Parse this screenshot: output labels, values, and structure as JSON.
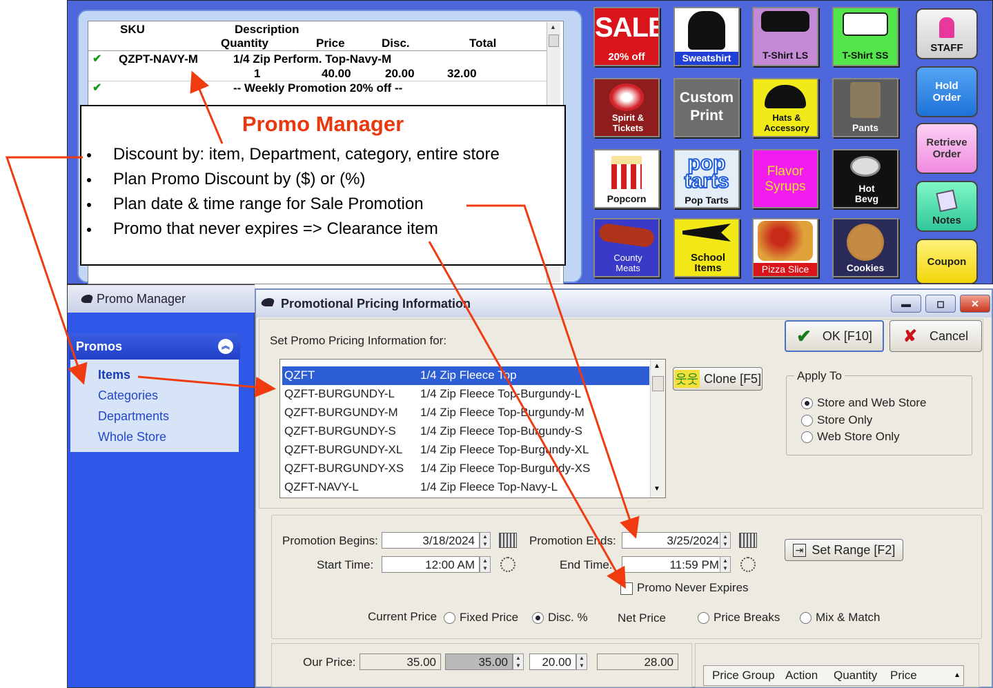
{
  "receipt": {
    "headers": {
      "sku": "SKU",
      "description": "Description",
      "quantity": "Quantity",
      "price": "Price",
      "disc": "Disc.",
      "total": "Total"
    },
    "line1": {
      "sku": "QZPT-NAVY-M",
      "description": "1/4 Zip Perform. Top-Navy-M",
      "quantity": "1",
      "price": "40.00",
      "disc": "20.00",
      "total": "32.00"
    },
    "line2": {
      "text": "-- Weekly Promotion 20% off --"
    }
  },
  "callout": {
    "title": "Promo Manager",
    "bullets": [
      "Discount by: item, Department, category, entire store",
      "Plan Promo Discount by ($) or (%)",
      "Plan date & time range for Sale Promotion",
      "Promo that never expires => Clearance item"
    ]
  },
  "tiles": [
    {
      "label": "SALE",
      "sub": "20% off"
    },
    {
      "label": "Sweatshirt"
    },
    {
      "label": "T-Shirt LS"
    },
    {
      "label": "T-Shirt SS"
    },
    {
      "label": "STAFF"
    },
    {
      "label": "Spirit & Tickets"
    },
    {
      "label": "Custom Print"
    },
    {
      "label": "Hats & Accessory"
    },
    {
      "label": "Pants"
    },
    {
      "label": "Hold Order"
    },
    {
      "label": "Popcorn"
    },
    {
      "label": "Pop Tarts"
    },
    {
      "label": "Flavor Syrups"
    },
    {
      "label": "Hot Bevg"
    },
    {
      "label": "Retrieve Order"
    },
    {
      "label": "County Meats"
    },
    {
      "label": "School Items"
    },
    {
      "label": "Pizza Slice"
    },
    {
      "label": "Cookies"
    },
    {
      "label": "Notes"
    },
    {
      "label": "Coupon"
    }
  ],
  "tile_text": {
    "poptarts_logo": "pop tarts"
  },
  "promo_manager": {
    "title": "Promo Manager",
    "section": "Promos",
    "links": [
      "Items",
      "Categories",
      "Departments",
      "Whole Store"
    ]
  },
  "ppi": {
    "title": "Promotional Pricing Information",
    "set_for_label": "Set Promo Pricing Information for:",
    "ok_label": "OK [F10]",
    "cancel_label": "Cancel",
    "clone_label": "Clone [F5]",
    "items": [
      {
        "sku": "QZFT",
        "desc": "1/4 Zip Fleece Top"
      },
      {
        "sku": "QZFT-BURGUNDY-L",
        "desc": "1/4 Zip Fleece Top-Burgundy-L"
      },
      {
        "sku": "QZFT-BURGUNDY-M",
        "desc": "1/4 Zip Fleece Top-Burgundy-M"
      },
      {
        "sku": "QZFT-BURGUNDY-S",
        "desc": "1/4 Zip Fleece Top-Burgundy-S"
      },
      {
        "sku": "QZFT-BURGUNDY-XL",
        "desc": "1/4 Zip Fleece Top-Burgundy-XL"
      },
      {
        "sku": "QZFT-BURGUNDY-XS",
        "desc": "1/4 Zip Fleece Top-Burgundy-XS"
      },
      {
        "sku": "QZFT-NAVY-L",
        "desc": "1/4 Zip Fleece Top-Navy-L"
      }
    ],
    "apply_to": {
      "label": "Apply To",
      "options": [
        "Store and Web Store",
        "Store Only",
        "Web Store Only"
      ],
      "selected": "Store and Web Store"
    },
    "begins_label": "Promotion Begins:",
    "begins_value": "3/18/2024",
    "ends_label": "Promotion Ends:",
    "ends_value": "3/25/2024",
    "start_time_label": "Start Time:",
    "start_time_value": "12:00 AM",
    "end_time_label": "End Time:",
    "end_time_value": "11:59 PM",
    "set_range_label": "Set Range [F2]",
    "never_expires_label": "Promo Never Expires",
    "current_price_label": "Current Price",
    "pricing_options": [
      "Fixed Price",
      "Disc. %",
      "Price Breaks",
      "Mix & Match"
    ],
    "pricing_selected": "Disc. %",
    "net_price_label": "Net Price",
    "our_price_label": "Our Price:",
    "our_price": "35.00",
    "current_price": "35.00",
    "disc_value": "20.00",
    "net_price": "28.00",
    "grid_headers": [
      "Price Group",
      "Action",
      "Quantity",
      "Price"
    ]
  }
}
